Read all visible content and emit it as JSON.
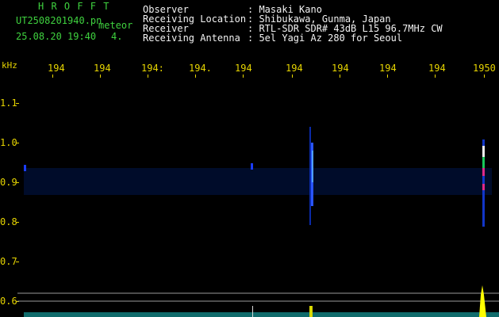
{
  "header": {
    "station_code": "H R O F F T",
    "file_name": "UT2508201940.pn",
    "mode_label": "meteor",
    "datetime": "25.08.20 19:40",
    "count": "4.",
    "observer_label": "Observer",
    "observer_value": ": Masaki Kano",
    "location_label": "Receiving Location",
    "location_value": ": Shibukawa, Gunma, Japan",
    "receiver_label": "Receiver",
    "receiver_value": ": RTL-SDR SDR# 43dB L15 96.7MHz CW",
    "antenna_label": "Receiving Antenna",
    "antenna_value": ": 5el Yagi Az 280 for Seoul"
  },
  "axes": {
    "y_unit": "kHz",
    "y_ticks": [
      "1.1",
      "1.0",
      "0.9",
      "0.8",
      "0.7",
      "0.6"
    ],
    "x_ticks": [
      "194",
      "194",
      "194:",
      "194.",
      "194",
      "194",
      "194",
      "194",
      "194",
      "1950"
    ]
  },
  "colors": {
    "label_green": "#3fd23f",
    "axis_yellow": "#e6d400",
    "background": "#000000",
    "signal_blue": "#1a3cff"
  }
}
